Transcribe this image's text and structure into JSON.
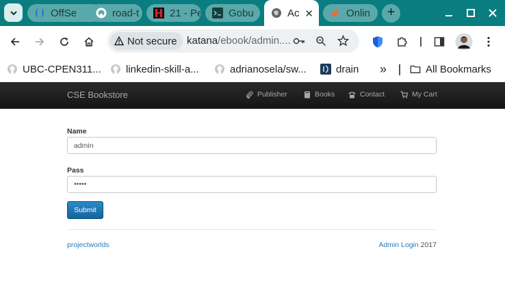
{
  "browser": {
    "tabs": [
      {
        "title": "OffSe",
        "icon": "offsec-icon"
      },
      {
        "title": "road-t",
        "icon": "github-icon"
      },
      {
        "title": "21 - Pe",
        "icon": "red-h-icon"
      },
      {
        "title": "Gobu",
        "icon": "terminal-icon"
      },
      {
        "title": "Ac",
        "icon": "globe-icon",
        "active": true
      },
      {
        "title": "Onlin",
        "icon": "orange-leaf-icon"
      }
    ],
    "security_label": "Not secure",
    "url_host": "katana",
    "url_path": "/ebook/admin....",
    "bookmarks": [
      {
        "label": "UBC-CPEN311...",
        "icon": "github-icon"
      },
      {
        "label": "linkedin-skill-a...",
        "icon": "github-icon"
      },
      {
        "label": "adrianosela/sw...",
        "icon": "github-icon"
      },
      {
        "label": "drain",
        "icon": "drain-icon"
      }
    ],
    "bookmarks_overflow": "»",
    "all_bookmarks": "All Bookmarks"
  },
  "site": {
    "brand": "CSE Bookstore",
    "nav": [
      {
        "label": "Publisher",
        "icon": "paperclip-icon"
      },
      {
        "label": "Books",
        "icon": "book-icon"
      },
      {
        "label": "Contact",
        "icon": "phone-icon"
      },
      {
        "label": "My Cart",
        "icon": "cart-icon"
      }
    ]
  },
  "form": {
    "name_label": "Name",
    "name_value": "admin",
    "pass_label": "Pass",
    "pass_value": "•••••",
    "submit_label": "Submit"
  },
  "footer": {
    "left": "projectworlds",
    "admin_link": "Admin Login",
    "year": "2017"
  },
  "colors": {
    "tabstrip": "#0a7d80",
    "navbar": "#1e1e1e",
    "primary_button": "#1e74b0",
    "link": "#2a7ab7"
  }
}
